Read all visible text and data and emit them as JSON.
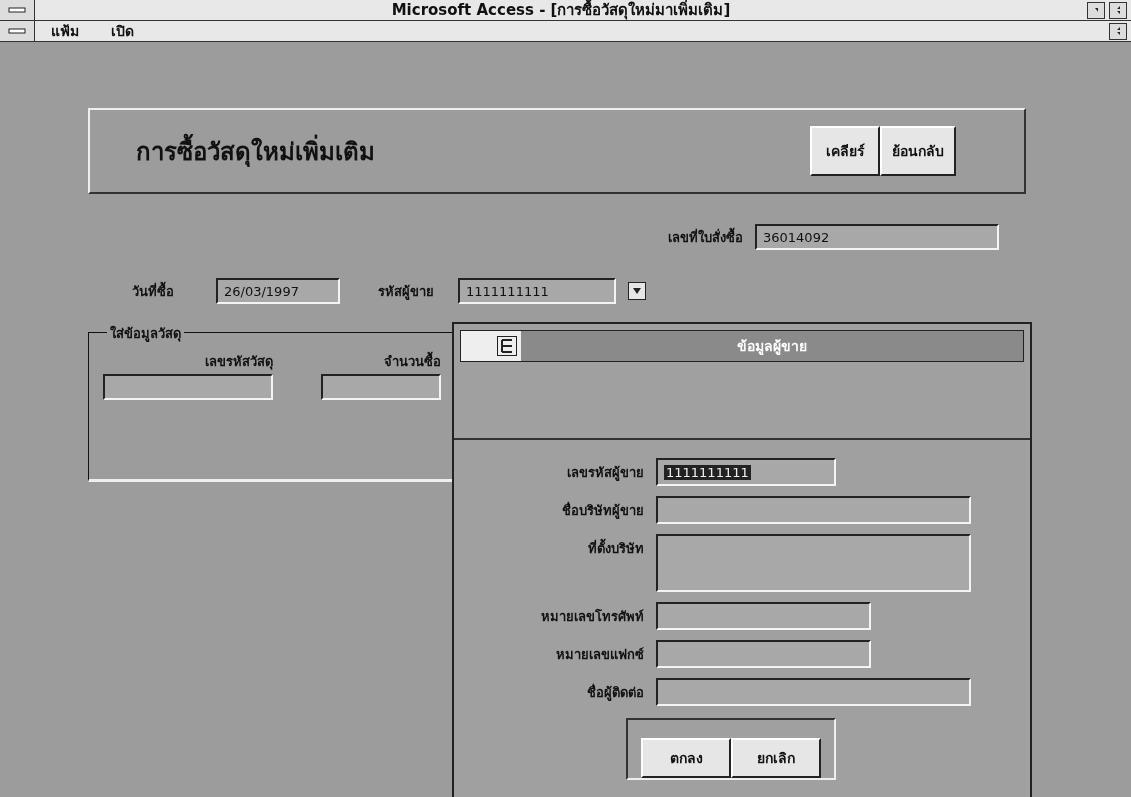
{
  "window": {
    "title": "Microsoft Access - [การซื้อวัสดุใหม่มาเพิ่มเติม]"
  },
  "menu": [
    "แฟ้ม",
    "เปิด"
  ],
  "form": {
    "heading": "การซื้อวัสดุใหม่เพิ่มเติม",
    "buttons": [
      "เคลียร์",
      "ย้อนกลับ"
    ],
    "order_number": {
      "label": "เลขที่ใบสั่งซื้อ",
      "value": "36014092"
    },
    "purchase_date": {
      "label": "วันที่ซื้อ",
      "value": "26/03/1997"
    },
    "supplier_code": {
      "label": "รหัสผู้ขาย",
      "value": "1111111111"
    },
    "material_group": {
      "title": "ใส่ข้อมูลวัสดุ",
      "fields": [
        {
          "label": "เลขรหัสวัสดุ"
        },
        {
          "label": "จำนวนซื้อ"
        }
      ]
    }
  },
  "dialog": {
    "title": "ข้อมูลผู้ขาย",
    "fields": [
      {
        "label": "เลขรหัสผู้ขาย",
        "value": "1111111111",
        "kind": "short",
        "highlighted": true
      },
      {
        "label": "ชื่อบริษัทผู้ขาย",
        "kind": "long"
      },
      {
        "label": "ที่ตั้งบริษัท",
        "kind": "multiline"
      },
      {
        "label": "หมายเลขโทรศัพท์",
        "kind": "medium"
      },
      {
        "label": "หมายเลขแฟกซ์",
        "kind": "medium"
      },
      {
        "label": "ชื่อผู้ติดต่อ",
        "kind": "long"
      }
    ],
    "buttons": [
      "ตกลง",
      "ยกเลิก"
    ]
  }
}
